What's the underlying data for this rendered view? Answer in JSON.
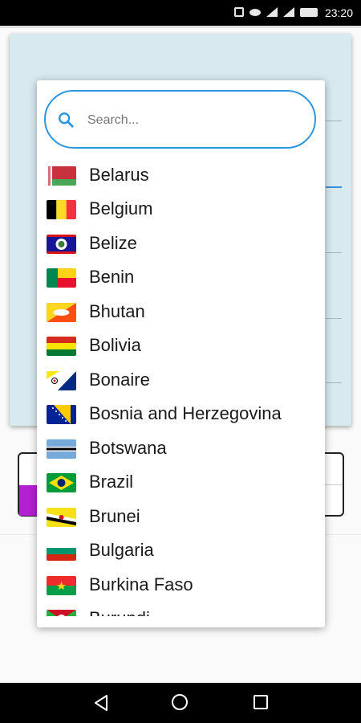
{
  "status_bar": {
    "time": "23:20",
    "icons": [
      "vibrate-icon",
      "eye-icon",
      "signal-icon",
      "signal-icon",
      "battery-icon"
    ]
  },
  "search": {
    "placeholder": "Search...",
    "value": "",
    "icon": "search-icon",
    "accent": "#2b96e0"
  },
  "countries": [
    {
      "name": "Belarus",
      "flag": "belarus-flag-icon"
    },
    {
      "name": "Belgium",
      "flag": "belgium-flag-icon"
    },
    {
      "name": "Belize",
      "flag": "belize-flag-icon"
    },
    {
      "name": "Benin",
      "flag": "benin-flag-icon"
    },
    {
      "name": "Bhutan",
      "flag": "bhutan-flag-icon"
    },
    {
      "name": "Bolivia",
      "flag": "bolivia-flag-icon"
    },
    {
      "name": "Bonaire",
      "flag": "bonaire-flag-icon"
    },
    {
      "name": "Bosnia and Herzegovina",
      "flag": "bosnia-flag-icon"
    },
    {
      "name": "Botswana",
      "flag": "botswana-flag-icon"
    },
    {
      "name": "Brazil",
      "flag": "brazil-flag-icon"
    },
    {
      "name": "Brunei",
      "flag": "brunei-flag-icon"
    },
    {
      "name": "Bulgaria",
      "flag": "bulgaria-flag-icon"
    },
    {
      "name": "Burkina Faso",
      "flag": "burkina-faso-flag-icon"
    },
    {
      "name": "Burundi",
      "flag": "burundi-flag-icon"
    }
  ],
  "nav_bar": {
    "icons": [
      "back-icon",
      "home-icon",
      "recent-apps-icon"
    ]
  },
  "colors": {
    "background_card": "#d8e9f0",
    "purple_bar": "#b31fd3"
  }
}
